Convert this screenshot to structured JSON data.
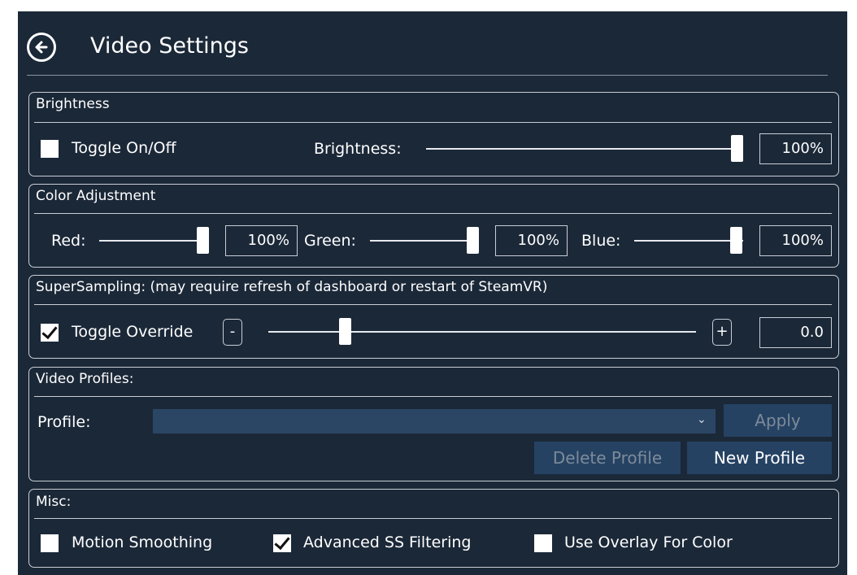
{
  "header": {
    "title": "Video Settings",
    "back_icon": "arrow-left-circle-icon"
  },
  "brightness": {
    "section_title": "Brightness",
    "toggle_label": "Toggle On/Off",
    "toggle_checked": false,
    "slider_label": "Brightness:",
    "slider_level": 1.0,
    "value": "100%"
  },
  "color_adjustment": {
    "section_title": "Color Adjustment",
    "red": {
      "label": "Red:",
      "level": 1.0,
      "value": "100%"
    },
    "green": {
      "label": "Green:",
      "level": 1.0,
      "value": "100%"
    },
    "blue": {
      "label": "Blue:",
      "level": 1.0,
      "value": "100%"
    }
  },
  "supersampling": {
    "section_title": "SuperSampling: (may require refresh of dashboard or restart of SteamVR)",
    "toggle_label": "Toggle Override",
    "toggle_checked": true,
    "minus_label": "-",
    "plus_label": "+",
    "slider_level": 0.17,
    "value": "0.0"
  },
  "video_profiles": {
    "section_title": "Video Profiles:",
    "profile_label": "Profile:",
    "selected_profile": "",
    "apply_label": "Apply",
    "delete_label": "Delete Profile",
    "new_label": "New Profile"
  },
  "misc": {
    "section_title": "Misc:",
    "motion_smoothing": {
      "label": "Motion Smoothing",
      "checked": false
    },
    "advanced_ss": {
      "label": "Advanced SS Filtering",
      "checked": true
    },
    "overlay_color": {
      "label": "Use Overlay For Color",
      "checked": false
    }
  },
  "colors": {
    "background": "#1b2838",
    "button": "#254263",
    "dropdown": "#2b4665"
  }
}
